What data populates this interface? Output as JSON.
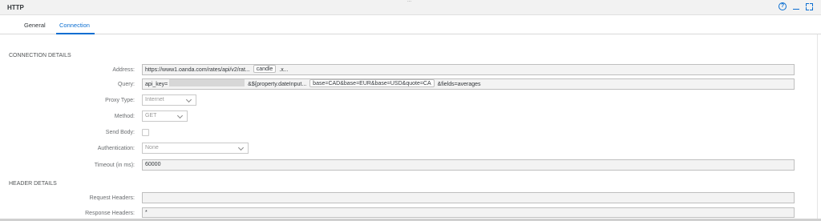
{
  "window": {
    "title": "HTTP",
    "grip": "..."
  },
  "header_icons": {
    "help": "help-icon",
    "minimize": "minimize-icon",
    "maximize": "maximize-icon"
  },
  "tabs": [
    {
      "label": "General",
      "active": false
    },
    {
      "label": "Connection",
      "active": true
    }
  ],
  "connection_details": {
    "heading": "CONNECTION DETAILS",
    "address": {
      "label": "Address:",
      "prefix": "https://www1.oanda.com/rates/api/v2/rat...",
      "token": "candle",
      "suffix": ".x..."
    },
    "query": {
      "label": "Query:",
      "part1": "api_key=",
      "part2": "&${property.dateInput...",
      "token": "base=CAD&base=EUR&base=USD&quote=CA",
      "part3": "&fields=averages"
    },
    "proxy_type": {
      "label": "Proxy Type:",
      "value": "Internet"
    },
    "method": {
      "label": "Method:",
      "value": "GET"
    },
    "send_body": {
      "label": "Send Body:",
      "checked": false
    },
    "authentication": {
      "label": "Authentication:",
      "value": "None"
    },
    "timeout": {
      "label": "Timeout (in ms):",
      "value": "60000"
    }
  },
  "header_details": {
    "heading": "HEADER DETAILS",
    "request_headers": {
      "label": "Request Headers:",
      "value": ""
    },
    "response_headers": {
      "label": "Response Headers:",
      "value": "*"
    }
  },
  "colors": {
    "accent": "#0a6ed1",
    "field_bg": "#f3f3f3",
    "titlebar_bg": "#f2f2f2"
  }
}
